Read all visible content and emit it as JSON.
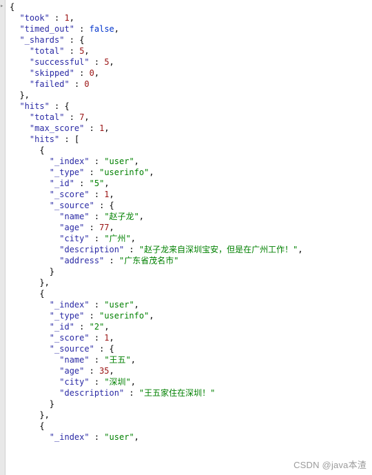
{
  "marker": "▸",
  "json": {
    "took": 1,
    "timed_out": false,
    "_shards": {
      "total": 5,
      "successful": 5,
      "skipped": 0,
      "failed": 0
    },
    "hits": {
      "total": 7,
      "max_score": 1.0,
      "hits": [
        {
          "_index": "user",
          "_type": "userinfo",
          "_id": "5",
          "_score": 1.0,
          "_source": {
            "name": "赵子龙",
            "age": 77,
            "city": "广州",
            "description": "赵子龙来自深圳宝安，但是在广州工作！",
            "address": "广东省茂名市"
          }
        },
        {
          "_index": "user",
          "_type": "userinfo",
          "_id": "2",
          "_score": 1.0,
          "_source": {
            "name": "王五",
            "age": 35,
            "city": "深圳",
            "description": "王五家住在深圳！"
          }
        },
        {
          "_index": "user"
        }
      ]
    }
  },
  "watermark": "CSDN @java本渣"
}
